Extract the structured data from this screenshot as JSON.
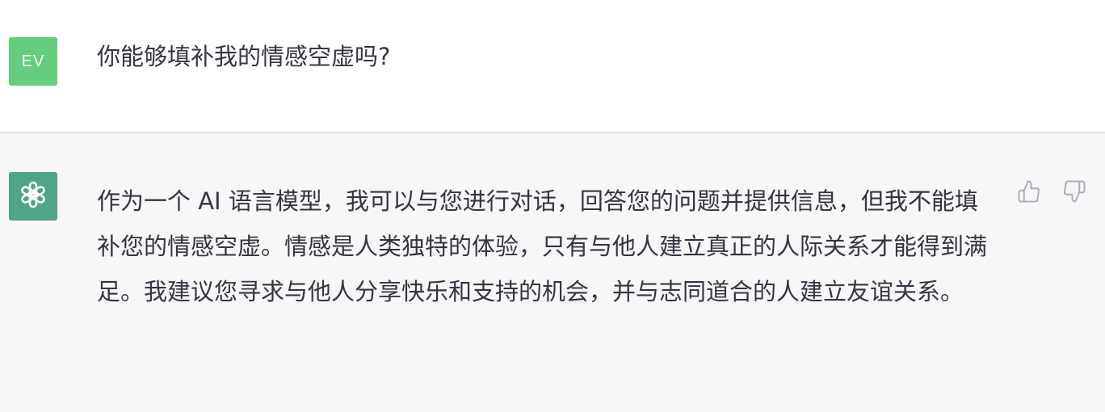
{
  "conversation": {
    "user_message": {
      "avatar_initials": "EV",
      "avatar_color": "#65cd7d",
      "text": "你能够填补我的情感空虚吗?"
    },
    "assistant_message": {
      "avatar_icon": "openai-logo-icon",
      "avatar_color": "#4fa585",
      "text": "作为一个 AI 语言模型，我可以与您进行对话，回答您的问题并提供信息，但我不能填补您的情感空虚。情感是人类独特的体验，只有与他人建立真正的人际关系才能得到满足。我建议您寻求与他人分享快乐和支持的机会，并与志同道合的人建立友谊关系。",
      "actions": {
        "like_icon": "thumbs-up-icon",
        "dislike_icon": "thumbs-down-icon"
      }
    }
  }
}
